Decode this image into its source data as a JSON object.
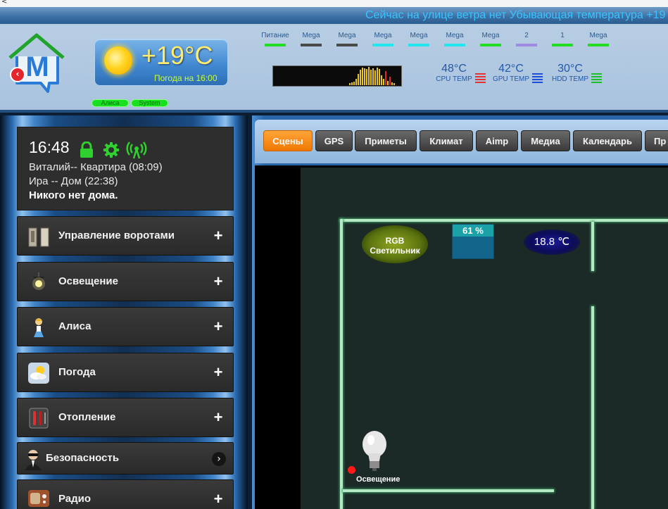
{
  "top": {
    "arrow": "<"
  },
  "header": {
    "marquee": "Сейчас на улице ветра нет Убывающая температура +19",
    "logo_letter": "M",
    "back_glyph": "‹",
    "weather": {
      "temp": "+19°C",
      "subtitle": "Погода на 16:00"
    },
    "pills": [
      "Алиса",
      "System"
    ],
    "indicators": [
      {
        "label": "Питание",
        "color": "#22dd22"
      },
      {
        "label": "Mega",
        "color": "#4a4a4a"
      },
      {
        "label": "Mega",
        "color": "#4a4a4a"
      },
      {
        "label": "Mega",
        "color": "#22e6ee"
      },
      {
        "label": "Mega",
        "color": "#22e6ee"
      },
      {
        "label": "Mega",
        "color": "#22e6ee"
      },
      {
        "label": "Mega",
        "color": "#22dd22"
      },
      {
        "label": "2",
        "color": "#9c8be0"
      },
      {
        "label": "1",
        "color": "#22dd22"
      },
      {
        "label": "Mega",
        "color": "#22dd22"
      }
    ],
    "temps": [
      {
        "value": "48°C",
        "label": "CPU TEMP",
        "color": "#e8302e"
      },
      {
        "value": "42°C",
        "label": "GPU TEMP",
        "color": "#1f4fd6"
      },
      {
        "value": "30°C",
        "label": "HDD TEMP",
        "color": "#1fbf2c"
      }
    ]
  },
  "status": {
    "time": "16:48",
    "line1": "Виталий-- Квартира (08:09)",
    "line2": "Ира -- Дом (22:38)",
    "line3": "Никого нет дома."
  },
  "menu": [
    {
      "label": "Управление воротами",
      "icon": "gate-icon",
      "action": "+"
    },
    {
      "label": "Освещение",
      "icon": "lamp-icon",
      "action": "+"
    },
    {
      "label": "Алиса",
      "icon": "alice-icon",
      "action": "+"
    },
    {
      "label": "Погода",
      "icon": "weather-icon",
      "action": "+"
    },
    {
      "label": "Отопление",
      "icon": "heating-icon",
      "action": "+"
    },
    {
      "label": "Безопасность",
      "icon": "security-icon",
      "action": "›"
    },
    {
      "label": "Радио",
      "icon": "radio-icon",
      "action": "+"
    }
  ],
  "tabs": [
    "Сцены",
    "GPS",
    "Приметы",
    "Климат",
    "Aimp",
    "Медиа",
    "Календарь",
    "Пр"
  ],
  "scene": {
    "rgb_label_1": "RGB",
    "rgb_label_2": "Светильник",
    "humidity": "61 %",
    "temperature": "18.8 ℃",
    "lamp_label": "Освещение"
  }
}
